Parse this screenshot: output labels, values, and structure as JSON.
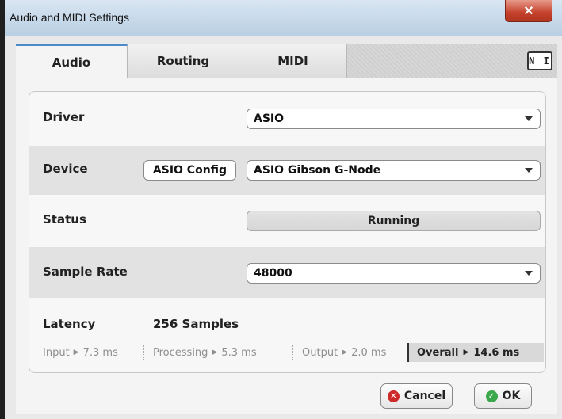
{
  "window": {
    "title": "Audio and MIDI Settings"
  },
  "tabs": [
    {
      "label": "Audio",
      "active": true
    },
    {
      "label": "Routing",
      "active": false
    },
    {
      "label": "MIDI",
      "active": false
    }
  ],
  "brand_icon": "native-instruments-logo",
  "brand_text": "N I",
  "settings": {
    "driver": {
      "label": "Driver",
      "value": "ASIO"
    },
    "device": {
      "label": "Device",
      "config_button": "ASIO Config",
      "value": "ASIO Gibson G-Node"
    },
    "status": {
      "label": "Status",
      "value": "Running"
    },
    "sample_rate": {
      "label": "Sample Rate",
      "value": "48000"
    },
    "latency": {
      "label": "Latency",
      "value": "256 Samples",
      "input": {
        "label": "Input",
        "value": "7.3 ms"
      },
      "processing": {
        "label": "Processing",
        "value": "5.3 ms"
      },
      "output": {
        "label": "Output",
        "value": "2.0 ms"
      },
      "overall": {
        "label": "Overall",
        "value": "14.6 ms"
      }
    }
  },
  "buttons": {
    "cancel": "Cancel",
    "ok": "OK"
  },
  "colors": {
    "active_tab_accent": "#4b8bc9",
    "close_button": "#c4412a",
    "cancel_icon": "#cf2a2a",
    "ok_icon": "#3aa74a"
  }
}
